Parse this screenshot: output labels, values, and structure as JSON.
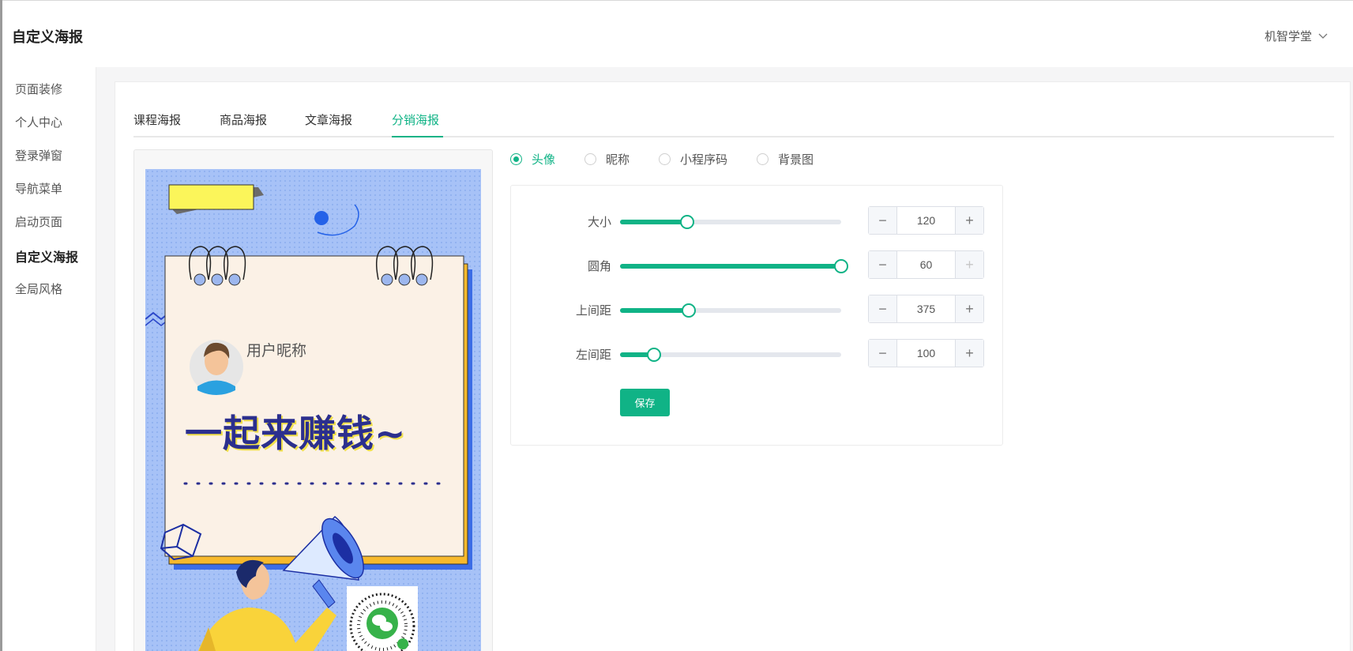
{
  "app": {
    "title": "自定义海报",
    "user_name": "机智学堂"
  },
  "sidebar": {
    "items": [
      {
        "label": "页面装修"
      },
      {
        "label": "个人中心"
      },
      {
        "label": "登录弹窗"
      },
      {
        "label": "导航菜单"
      },
      {
        "label": "启动页面"
      },
      {
        "label": "自定义海报",
        "active": true
      },
      {
        "label": "全局风格"
      }
    ]
  },
  "tabs": [
    {
      "label": "课程海报"
    },
    {
      "label": "商品海报"
    },
    {
      "label": "文章海报"
    },
    {
      "label": "分销海报",
      "active": true
    }
  ],
  "poster": {
    "nickname": "用户昵称",
    "slogan": "一起来赚钱~"
  },
  "element_options": [
    {
      "label": "头像",
      "checked": true
    },
    {
      "label": "昵称"
    },
    {
      "label": "小程序码"
    },
    {
      "label": "背景图"
    }
  ],
  "settings": [
    {
      "label": "大小",
      "value": "120",
      "slider_fraction": 0.305
    },
    {
      "label": "圆角",
      "value": "60",
      "slider_fraction": 1.0,
      "plus_disabled": true
    },
    {
      "label": "上间距",
      "value": "375",
      "slider_fraction": 0.31
    },
    {
      "label": "左间距",
      "value": "100",
      "slider_fraction": 0.155
    }
  ],
  "save_label": "保存",
  "colors": {
    "accent": "#10b386",
    "poster_bg": "#a7c2f7",
    "paper": "#fbf1e6",
    "slogan": "#2b2f8e"
  }
}
